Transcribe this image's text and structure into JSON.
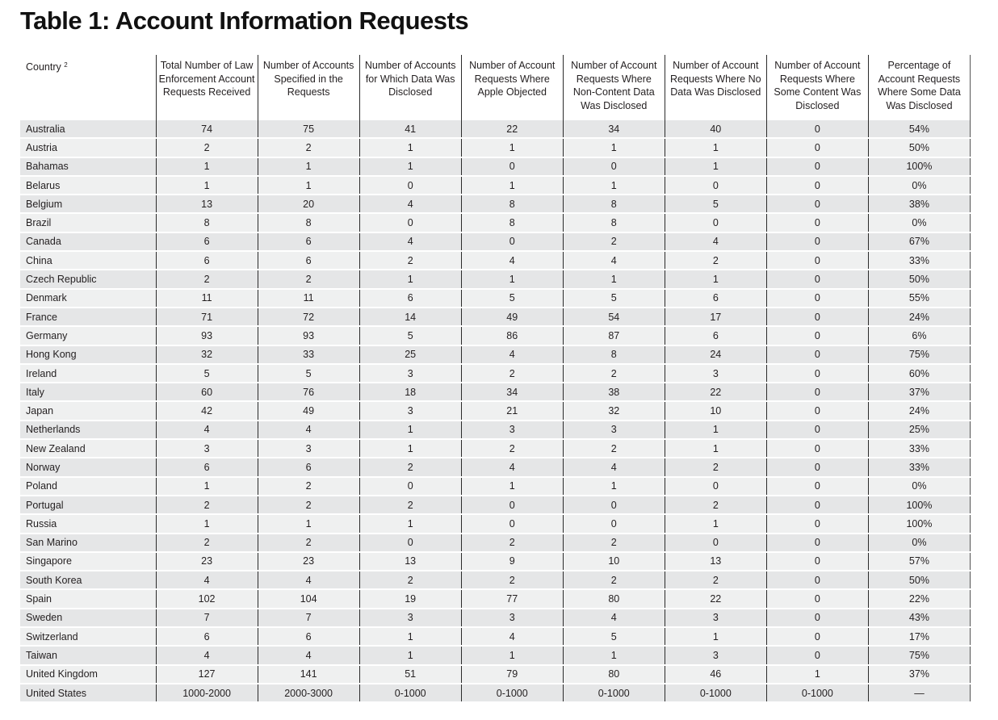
{
  "title": "Table 1: Account Information Requests",
  "table": {
    "headers": [
      {
        "label": "Country",
        "footnote": "2"
      },
      {
        "label": "Total Number of Law Enforcement Account Requests Received"
      },
      {
        "label": "Number of Accounts Specified in the Requests"
      },
      {
        "label": "Number of Accounts for Which Data Was Disclosed"
      },
      {
        "label": "Number of Account Requests Where Apple Objected"
      },
      {
        "label": "Number of Account Requests Where Non-Content Data Was Disclosed"
      },
      {
        "label": "Number of Account Requests Where No Data Was Disclosed"
      },
      {
        "label": "Number of Account Requests Where Some Content Was Disclosed"
      },
      {
        "label": "Percentage of Account Requests Where Some Data Was Disclosed"
      }
    ],
    "rows": [
      [
        "Australia",
        "74",
        "75",
        "41",
        "22",
        "34",
        "40",
        "0",
        "54%"
      ],
      [
        "Austria",
        "2",
        "2",
        "1",
        "1",
        "1",
        "1",
        "0",
        "50%"
      ],
      [
        "Bahamas",
        "1",
        "1",
        "1",
        "0",
        "0",
        "1",
        "0",
        "100%"
      ],
      [
        "Belarus",
        "1",
        "1",
        "0",
        "1",
        "1",
        "0",
        "0",
        "0%"
      ],
      [
        "Belgium",
        "13",
        "20",
        "4",
        "8",
        "8",
        "5",
        "0",
        "38%"
      ],
      [
        "Brazil",
        "8",
        "8",
        "0",
        "8",
        "8",
        "0",
        "0",
        "0%"
      ],
      [
        "Canada",
        "6",
        "6",
        "4",
        "0",
        "2",
        "4",
        "0",
        "67%"
      ],
      [
        "China",
        "6",
        "6",
        "2",
        "4",
        "4",
        "2",
        "0",
        "33%"
      ],
      [
        "Czech Republic",
        "2",
        "2",
        "1",
        "1",
        "1",
        "1",
        "0",
        "50%"
      ],
      [
        "Denmark",
        "11",
        "11",
        "6",
        "5",
        "5",
        "6",
        "0",
        "55%"
      ],
      [
        "France",
        "71",
        "72",
        "14",
        "49",
        "54",
        "17",
        "0",
        "24%"
      ],
      [
        "Germany",
        "93",
        "93",
        "5",
        "86",
        "87",
        "6",
        "0",
        "6%"
      ],
      [
        "Hong Kong",
        "32",
        "33",
        "25",
        "4",
        "8",
        "24",
        "0",
        "75%"
      ],
      [
        "Ireland",
        "5",
        "5",
        "3",
        "2",
        "2",
        "3",
        "0",
        "60%"
      ],
      [
        "Italy",
        "60",
        "76",
        "18",
        "34",
        "38",
        "22",
        "0",
        "37%"
      ],
      [
        "Japan",
        "42",
        "49",
        "3",
        "21",
        "32",
        "10",
        "0",
        "24%"
      ],
      [
        "Netherlands",
        "4",
        "4",
        "1",
        "3",
        "3",
        "1",
        "0",
        "25%"
      ],
      [
        "New Zealand",
        "3",
        "3",
        "1",
        "2",
        "2",
        "1",
        "0",
        "33%"
      ],
      [
        "Norway",
        "6",
        "6",
        "2",
        "4",
        "4",
        "2",
        "0",
        "33%"
      ],
      [
        "Poland",
        "1",
        "2",
        "0",
        "1",
        "1",
        "0",
        "0",
        "0%"
      ],
      [
        "Portugal",
        "2",
        "2",
        "2",
        "0",
        "0",
        "2",
        "0",
        "100%"
      ],
      [
        "Russia",
        "1",
        "1",
        "1",
        "0",
        "0",
        "1",
        "0",
        "100%"
      ],
      [
        "San Marino",
        "2",
        "2",
        "0",
        "2",
        "2",
        "0",
        "0",
        "0%"
      ],
      [
        "Singapore",
        "23",
        "23",
        "13",
        "9",
        "10",
        "13",
        "0",
        "57%"
      ],
      [
        "South Korea",
        "4",
        "4",
        "2",
        "2",
        "2",
        "2",
        "0",
        "50%"
      ],
      [
        "Spain",
        "102",
        "104",
        "19",
        "77",
        "80",
        "22",
        "0",
        "22%"
      ],
      [
        "Sweden",
        "7",
        "7",
        "3",
        "3",
        "4",
        "3",
        "0",
        "43%"
      ],
      [
        "Switzerland",
        "6",
        "6",
        "1",
        "4",
        "5",
        "1",
        "0",
        "17%"
      ],
      [
        "Taiwan",
        "4",
        "4",
        "1",
        "1",
        "1",
        "3",
        "0",
        "75%"
      ],
      [
        "United Kingdom",
        "127",
        "141",
        "51",
        "79",
        "80",
        "46",
        "1",
        "37%"
      ],
      [
        "United States",
        "1000-2000",
        "2000-3000",
        "0-1000",
        "0-1000",
        "0-1000",
        "0-1000",
        "0-1000",
        "—"
      ]
    ]
  },
  "colors": {
    "row_odd": "#e5e6e7",
    "row_even": "#eff0f0",
    "rule": "#2b2b2b"
  }
}
